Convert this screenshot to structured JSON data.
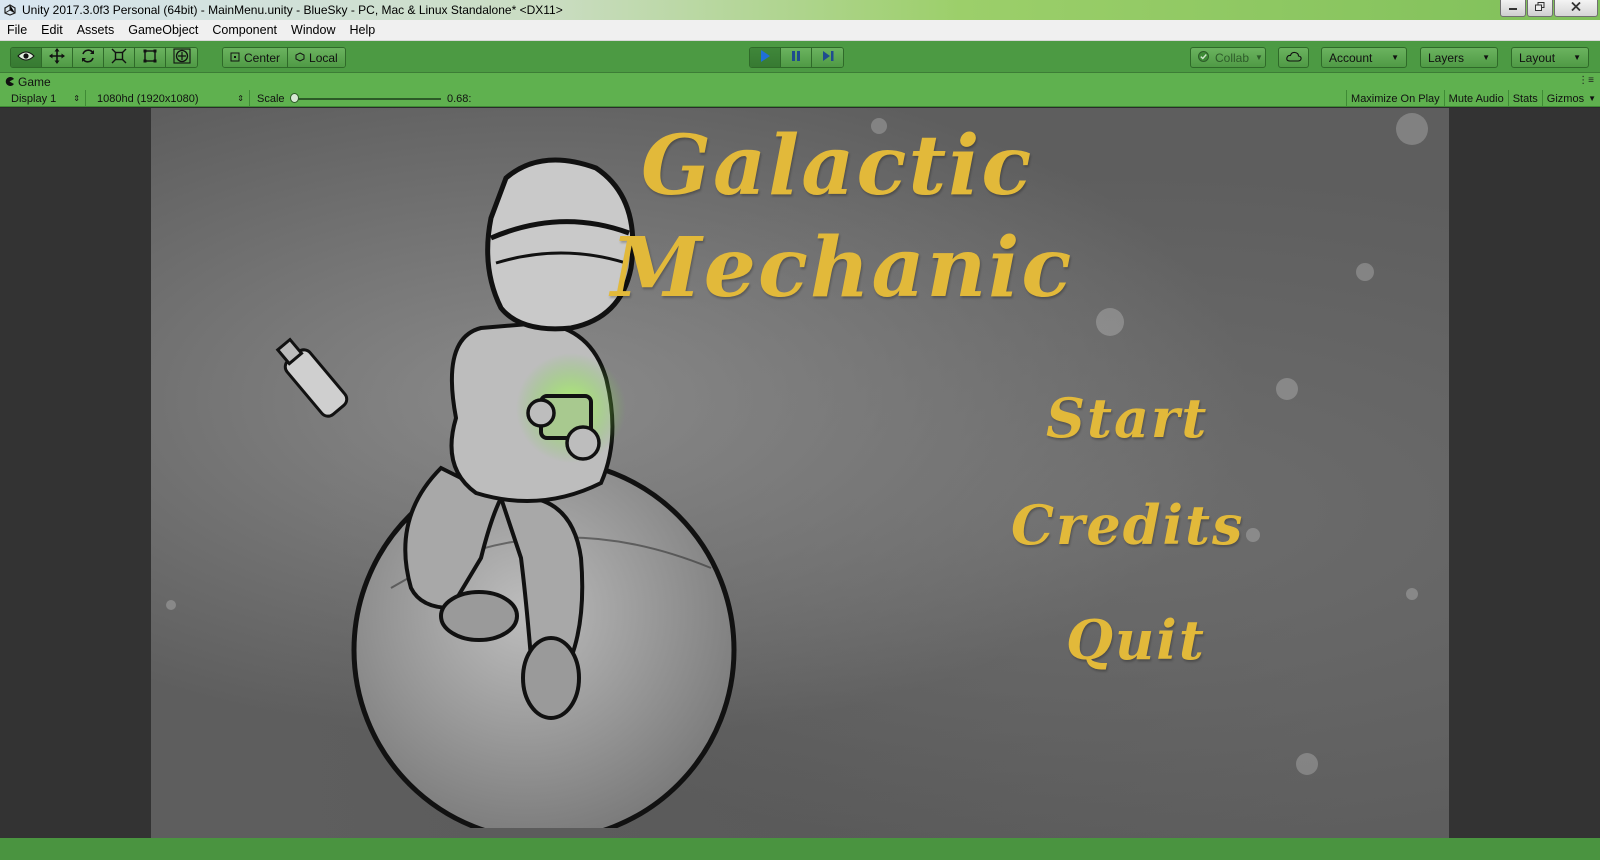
{
  "window": {
    "title": "Unity 2017.3.0f3 Personal (64bit) - MainMenu.unity - BlueSky - PC, Mac & Linux Standalone* <DX11>",
    "controls": [
      "minimize-icon",
      "restore-icon",
      "close-icon"
    ]
  },
  "menubar": {
    "items": [
      "File",
      "Edit",
      "Assets",
      "GameObject",
      "Component",
      "Window",
      "Help"
    ]
  },
  "toolbar": {
    "tools": [
      "hand-eye-icon",
      "move-icon",
      "rotate-icon",
      "scale-icon",
      "rect-icon",
      "transform-icon"
    ],
    "pivot_label": "Center",
    "space_label": "Local",
    "playback": [
      "play-icon",
      "pause-icon",
      "step-icon"
    ],
    "collab_label": "Collab",
    "account_label": "Account",
    "layers_label": "Layers",
    "layout_label": "Layout"
  },
  "game_tab": {
    "label": "Game"
  },
  "game_toolbar": {
    "display": "Display 1",
    "resolution": "1080hd (1920x1080)",
    "scale_label": "Scale",
    "scale_value": "0.68:",
    "scale_fraction": 0.0,
    "right_buttons": [
      "Maximize On Play",
      "Mute Audio",
      "Stats",
      "Gizmos"
    ]
  },
  "game": {
    "title_line1": "Galactic",
    "title_line2": "Mechanic",
    "options": [
      "Start",
      "Credits",
      "Quit"
    ],
    "text_color": "#e2b93a"
  }
}
